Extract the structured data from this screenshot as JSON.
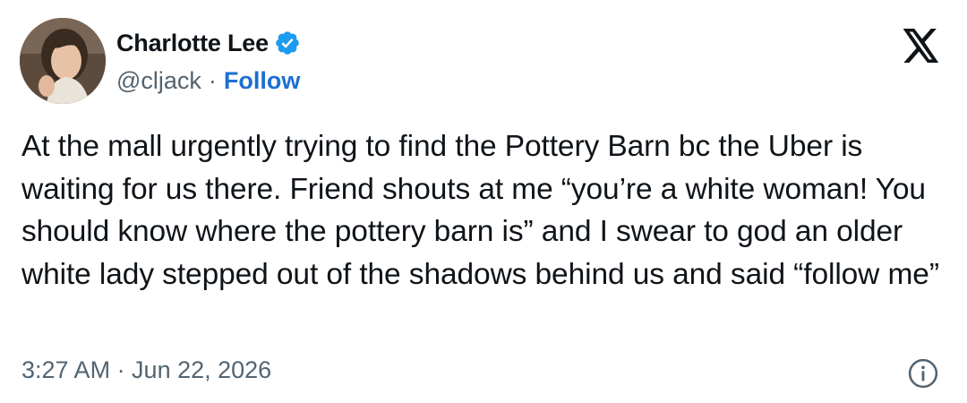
{
  "author": {
    "display_name": "Charlotte Lee",
    "handle": "@cljack",
    "separator": "·",
    "follow_label": "Follow",
    "verified": true,
    "verified_color": "#1d9bf0",
    "avatar_icon": "profile-photo"
  },
  "brand": {
    "logo_icon": "x-logo-icon"
  },
  "tweet": {
    "text": "At the mall urgently trying to find the Pottery Barn bc the Uber is waiting for us there. Friend shouts at me “you’re a white woman! You should know where the pottery barn is” and I swear to god an older white lady stepped out of the shadows behind us and said “follow me”",
    "timestamp": "3:27 AM · Jun 22, 2026"
  },
  "footer": {
    "info_icon": "info-icon"
  },
  "colors": {
    "text": "#0f1419",
    "secondary": "#536471",
    "link": "#1d6fd1",
    "verified": "#1d9bf0"
  }
}
